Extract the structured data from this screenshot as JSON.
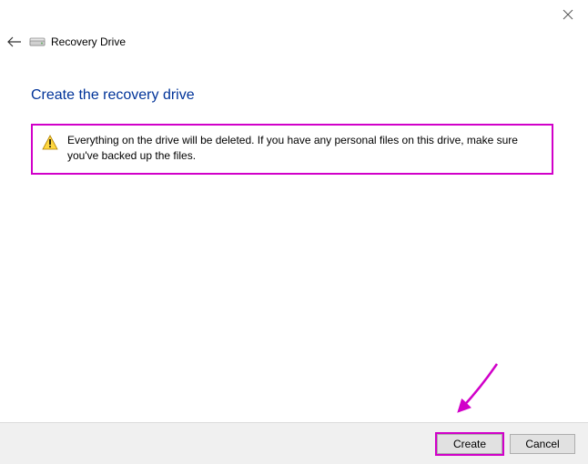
{
  "window": {
    "title": "Recovery Drive"
  },
  "heading": "Create the recovery drive",
  "warning": {
    "text": "Everything on the drive will be deleted. If you have any personal files on this drive, make sure you've backed up the files."
  },
  "buttons": {
    "create": "Create",
    "cancel": "Cancel"
  },
  "annotation": {
    "highlight_color": "#d100c9"
  }
}
